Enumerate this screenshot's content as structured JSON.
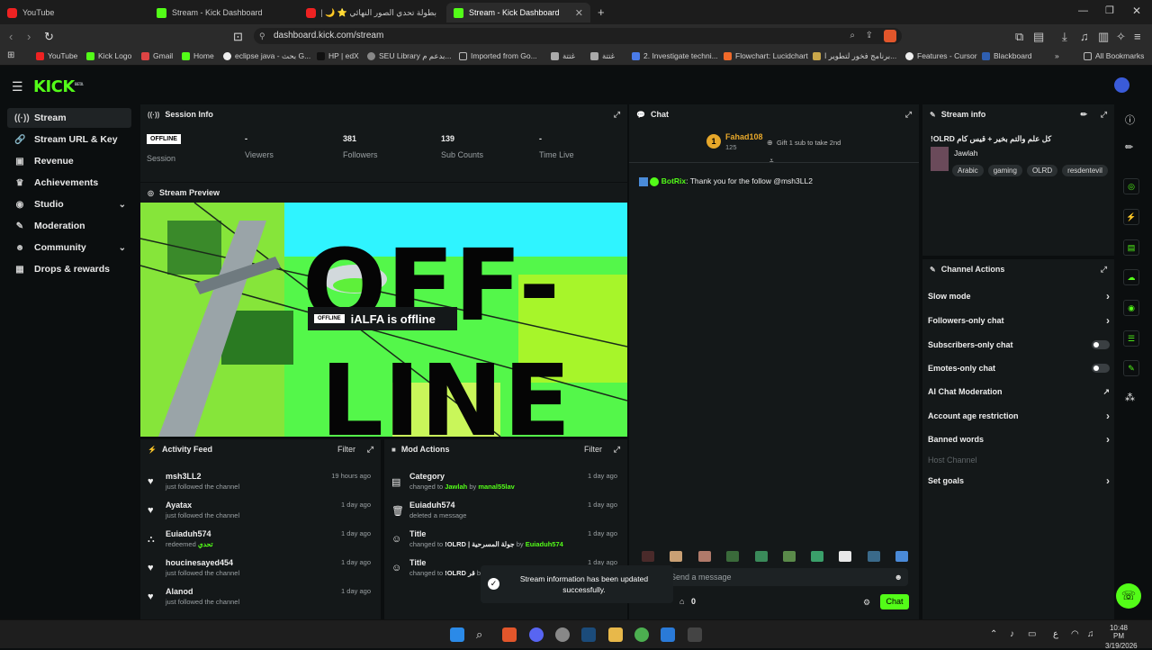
{
  "browser": {
    "tabs": [
      {
        "title": "YouTube",
        "favicon": "youtube-icon"
      },
      {
        "title": "Stream - Kick Dashboard",
        "favicon": "kick-icon"
      },
      {
        "title": "بطولة تحدي الصور النهائي ⭐ 🌙 | أوا...",
        "favicon": "youtube-icon"
      },
      {
        "title": "Stream - Kick Dashboard",
        "favicon": "kick-icon",
        "active": true
      }
    ],
    "url": "dashboard.kick.com/stream",
    "bookmarks": [
      "YouTube",
      "Kick Logo",
      "Gmail",
      "Home",
      "eclipse java - بحث G...",
      "HP | edX",
      "SEU Library بدعم م...",
      "Imported from Go...",
      "غتتة",
      "غتتة",
      "2. Investigate techni...",
      "Flowchart: Lucidchart",
      "برنامج فخور لتطوير ا...",
      "Features - Cursor",
      "Blackboard"
    ],
    "all_bookmarks": "All Bookmarks"
  },
  "app": {
    "logo": "KICK",
    "logo_sup": "BETA",
    "accent": "#53fc18"
  },
  "sidebar": {
    "items": [
      {
        "label": "Stream",
        "icon": "broadcast-icon"
      },
      {
        "label": "Stream URL & Key",
        "icon": "link-icon"
      },
      {
        "label": "Revenue",
        "icon": "wallet-icon"
      },
      {
        "label": "Achievements",
        "icon": "trophy-icon"
      },
      {
        "label": "Studio",
        "icon": "studio-icon"
      },
      {
        "label": "Moderation",
        "icon": "wrench-icon"
      },
      {
        "label": "Community",
        "icon": "users-icon"
      },
      {
        "label": "Drops & rewards",
        "icon": "gift-icon"
      }
    ]
  },
  "session": {
    "title": "Session Info",
    "status": "OFFLINE",
    "stats": [
      {
        "value": "",
        "label": "Session"
      },
      {
        "value": "-",
        "label": "Viewers"
      },
      {
        "value": "381",
        "label": "Followers"
      },
      {
        "value": "139",
        "label": "Sub Counts"
      },
      {
        "value": "-",
        "label": "Time Live"
      }
    ]
  },
  "preview": {
    "title": "Stream Preview",
    "badge": "OFFLINE",
    "message": "iALFA is offline",
    "big_text": [
      "OFF-",
      "LINE"
    ]
  },
  "activity": {
    "title": "Activity Feed",
    "filter": "Filter",
    "items": [
      {
        "name": "msh3LL2",
        "desc": "just followed the channel",
        "time": "19 hours ago",
        "icon": "heart-icon"
      },
      {
        "name": "Ayatax",
        "desc": "just followed the channel",
        "time": "1 day ago",
        "icon": "heart-icon"
      },
      {
        "name": "Euiaduh574",
        "desc_pre": "redeemed",
        "desc_hl": "تحدي",
        "time": "1 day ago",
        "icon": "reward-icon"
      },
      {
        "name": "houcinesayed454",
        "desc": "just followed the channel",
        "time": "1 day ago",
        "icon": "heart-icon"
      },
      {
        "name": "Alanod",
        "desc": "just followed the channel",
        "time": "1 day ago",
        "icon": "heart-icon"
      }
    ]
  },
  "mod_actions": {
    "title": "Mod Actions",
    "filter": "Filter",
    "items": [
      {
        "name": "Category",
        "desc_pre": "changed to",
        "hl1": "Jawlah",
        "mid": "by",
        "hl2": "manal55lav",
        "time": "1 day ago",
        "icon": "category-icon"
      },
      {
        "name": "Euiaduh574",
        "desc_pre": "deleted a message",
        "time": "1 day ago",
        "icon": "trash-icon"
      },
      {
        "name": "Title",
        "desc_pre": "changed to",
        "hl1": "!OLRD | جولة المسرحية",
        "mid": "by",
        "hl2": "Euiaduh574",
        "time": "1 day ago",
        "icon": "user-edit-icon"
      },
      {
        "name": "Title",
        "desc_pre": "changed to",
        "hl1": "!OLRD قر",
        "mid": "b",
        "hl2": "",
        "time": "1 day ago",
        "icon": "user-edit-icon"
      }
    ]
  },
  "chat": {
    "title": "Chat",
    "top_gifter": {
      "rank": "1",
      "name": "Fahad108",
      "count": "125",
      "hint": "Gift 1 sub to take 2nd"
    },
    "messages": [
      {
        "user": "BotRix",
        "text": "Thank you for the follow @msh3LL2"
      }
    ],
    "input_placeholder": "Send a message",
    "points": "0",
    "send_label": "Chat"
  },
  "stream_info": {
    "title": "Stream info",
    "stream_title": "!OLRD كل علم والتم بخير + قيس كام",
    "category": "Jawlah",
    "tags": [
      "Arabic",
      "gaming",
      "OLRD",
      "resdentevil"
    ]
  },
  "channel_actions": {
    "title": "Channel Actions",
    "rows": [
      {
        "label": "Slow mode",
        "control": "chevron"
      },
      {
        "label": "Followers-only chat",
        "control": "chevron"
      },
      {
        "label": "Subscribers-only chat",
        "control": "toggle"
      },
      {
        "label": "Emotes-only chat",
        "control": "toggle"
      },
      {
        "label": "AI Chat Moderation",
        "control": "external"
      },
      {
        "label": "Account age restriction",
        "control": "chevron"
      },
      {
        "label": "Banned words",
        "control": "chevron"
      },
      {
        "label": "Host Channel",
        "control": "none",
        "disabled": true
      },
      {
        "label": "Set goals",
        "control": "chevron"
      }
    ]
  },
  "toast": {
    "text": "Stream information has been updated successfully."
  },
  "taskbar": {
    "time": "10:48 PM",
    "date": "3/19/2026",
    "lang": "ع"
  }
}
